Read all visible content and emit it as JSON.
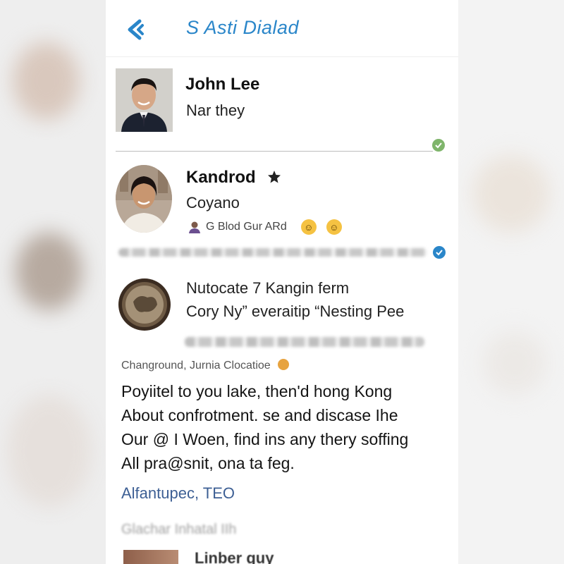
{
  "header": {
    "title": "S Asti Dialad"
  },
  "contacts": [
    {
      "name": "John Lee",
      "subtitle": "Nar they"
    },
    {
      "name": "Kandrod",
      "subtitle": "Coyano",
      "meta": "G Blod Gur ARd"
    }
  ],
  "post": {
    "heading_line1": "Nutocate 7 Kangin ferm",
    "heading_line2": "Cory Ny” everaitip “Nesting Pee",
    "tag": "Changround, Jurnia Clocatioe",
    "body": [
      "Poyiitel to you lake, then'd hong Kong",
      "About confrotment. se and discase Ihe",
      "Our @ I Woen, find ins any thery soffing",
      "All pra@snit, ona ta feg."
    ],
    "author": "Alfantupec, TEO"
  },
  "bottom": {
    "faded_label": "Glachar Inhatal IIh",
    "item_title": "Linber guy"
  },
  "colors": {
    "accent": "#2a86c9",
    "author": "#3d5f94",
    "verified": "#4caf50"
  },
  "icons": [
    "back-icon",
    "verified-icon",
    "star-badge-icon",
    "person-icon",
    "emoji-icon",
    "globe-icon"
  ]
}
